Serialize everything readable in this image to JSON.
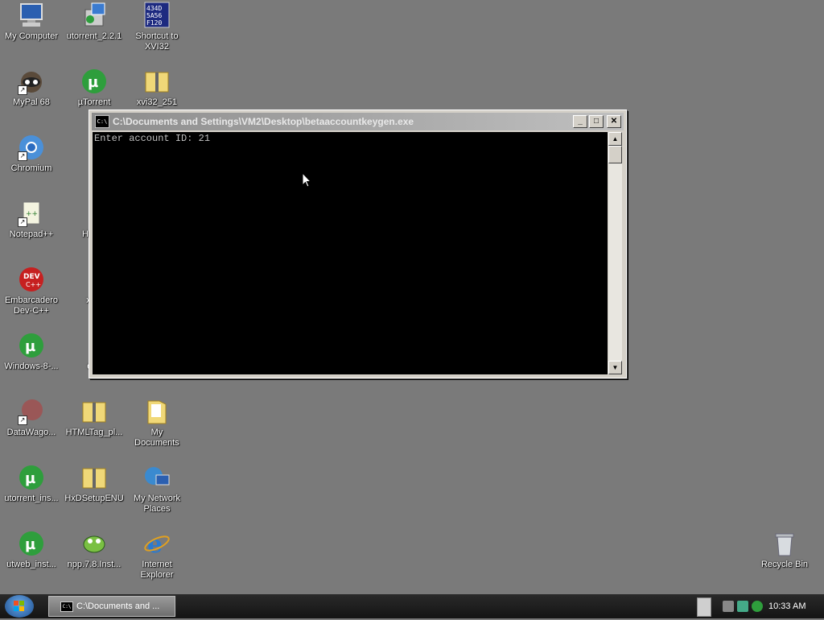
{
  "desktop": {
    "icons": [
      {
        "label": "My Computer",
        "icon": "my-computer-icon"
      },
      {
        "label": "utorrent_2.2.1",
        "icon": "installer-icon"
      },
      {
        "label": "Shortcut to\nXVI32",
        "icon": "hex-editor-icon"
      },
      {
        "label": "MyPal 68",
        "icon": "raccoon-icon"
      },
      {
        "label": "µTorrent",
        "icon": "utorrent-icon"
      },
      {
        "label": "xvi32_251",
        "icon": "zip-folder-icon"
      },
      {
        "label": "Chromium",
        "icon": "chromium-icon"
      },
      {
        "label": "Notepad++",
        "icon": "notepad-plus-plus-icon"
      },
      {
        "label": "HTML",
        "icon": "folder-icon"
      },
      {
        "label": "Embarcadero\nDev-C++",
        "icon": "dev-cpp-icon"
      },
      {
        "label": "xvi3",
        "icon": "zip-folder-icon"
      },
      {
        "label": "Windows-8-...",
        "icon": "utorrent-icon"
      },
      {
        "label": "exp",
        "icon": "document-icon"
      },
      {
        "label": "DataWago...",
        "icon": "app-icon"
      },
      {
        "label": "HTMLTag_pl...",
        "icon": "zip-folder-icon"
      },
      {
        "label": "My\nDocuments",
        "icon": "my-documents-icon"
      },
      {
        "label": "utorrent_ins...",
        "icon": "utorrent-icon"
      },
      {
        "label": "HxDSetupENU",
        "icon": "zip-folder-icon"
      },
      {
        "label": "My Network\nPlaces",
        "icon": "network-places-icon"
      },
      {
        "label": "utweb_inst...",
        "icon": "utorrent-icon"
      },
      {
        "label": "npp.7.8.Inst...",
        "icon": "npp-installer-icon"
      },
      {
        "label": "Internet\nExplorer",
        "icon": "internet-explorer-icon"
      },
      {
        "label": "Recycle Bin",
        "icon": "recycle-bin-icon"
      }
    ]
  },
  "console_window": {
    "title": "C:\\Documents and Settings\\VM2\\Desktop\\betaaccountkeygen.exe",
    "icon_text": "C:\\",
    "minimize": "_",
    "maximize": "□",
    "close": "✕",
    "output": "Enter account ID: 21"
  },
  "taskbar": {
    "task_label": "C:\\Documents and ...",
    "task_icon_text": "C:\\",
    "clock": "10:33 AM"
  },
  "colors": {
    "desktop_bg": "#7a7a7a",
    "console_bg": "#000000",
    "console_text": "#c0c0c0",
    "utorrent_green": "#2e9e3c"
  }
}
